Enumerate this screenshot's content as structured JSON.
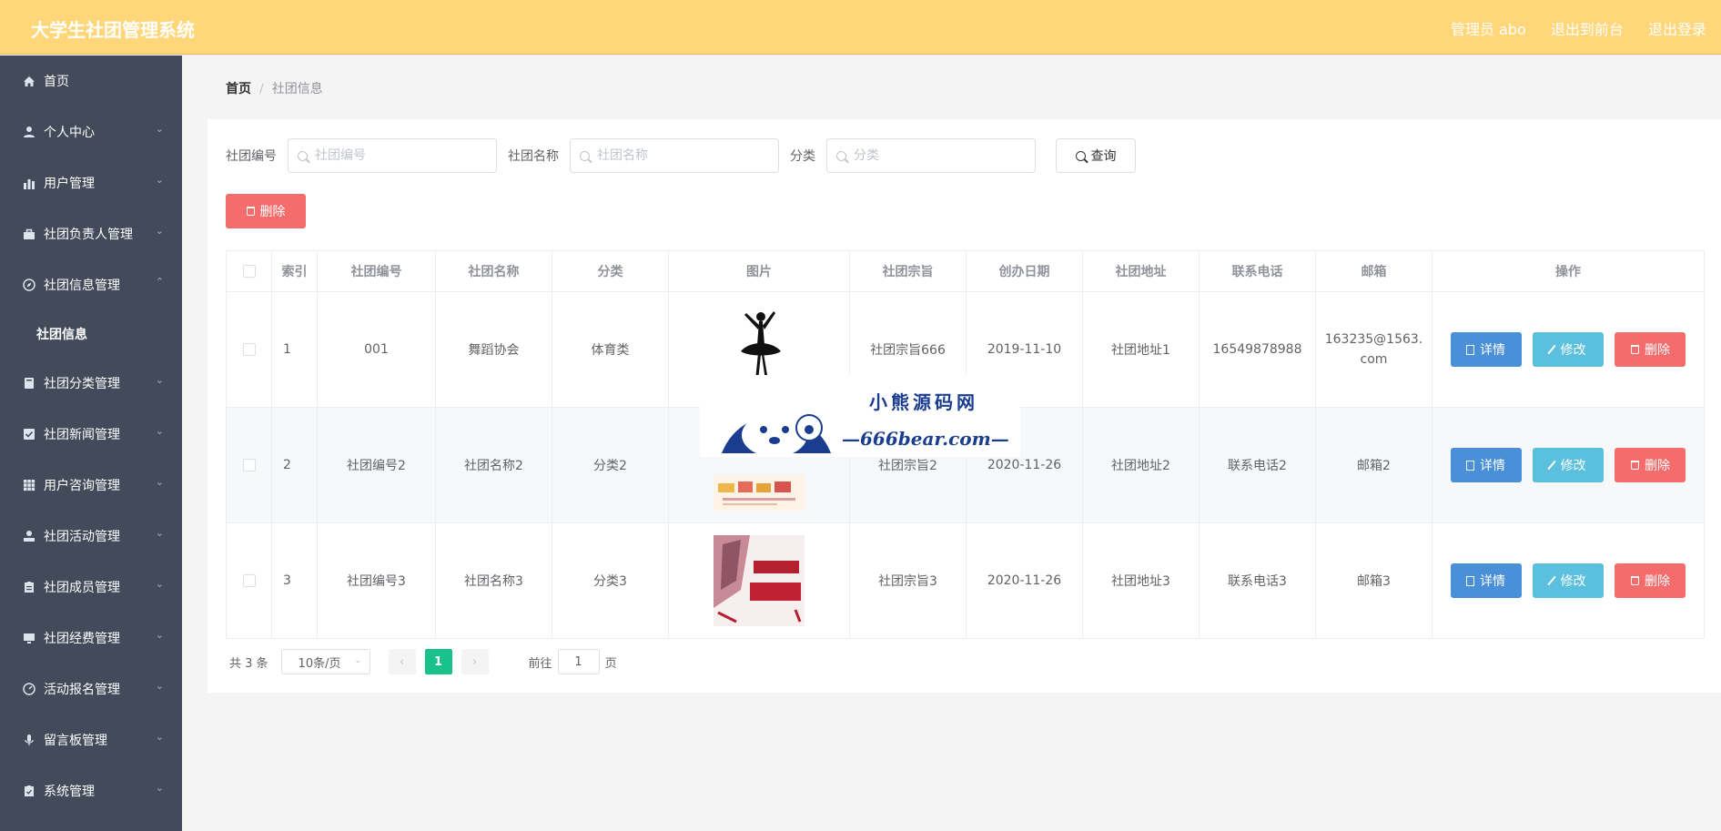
{
  "header": {
    "app_title": "大学生社团管理系统",
    "admin_label": "管理员 abo",
    "to_front_label": "退出到前台",
    "logout_label": "退出登录"
  },
  "sidebar": {
    "items": [
      {
        "label": "首页",
        "icon": "home-icon"
      },
      {
        "label": "个人中心",
        "icon": "user-icon"
      },
      {
        "label": "用户管理",
        "icon": "bar-chart-icon"
      },
      {
        "label": "社团负责人管理",
        "icon": "briefcase-icon"
      },
      {
        "label": "社团信息管理",
        "icon": "compass-icon"
      },
      {
        "label": "社团分类管理",
        "icon": "book-icon"
      },
      {
        "label": "社团新闻管理",
        "icon": "check-square-icon"
      },
      {
        "label": "用户咨询管理",
        "icon": "grid-icon"
      },
      {
        "label": "社团活动管理",
        "icon": "person-icon"
      },
      {
        "label": "社团成员管理",
        "icon": "clipboard-icon"
      },
      {
        "label": "社团经费管理",
        "icon": "monitor-icon"
      },
      {
        "label": "活动报名管理",
        "icon": "gauge-icon"
      },
      {
        "label": "留言板管理",
        "icon": "microphone-icon"
      },
      {
        "label": "系统管理",
        "icon": "clipboard-check-icon"
      }
    ],
    "sub_item": "社团信息"
  },
  "breadcrumb": {
    "home": "首页",
    "separator": "/",
    "current": "社团信息"
  },
  "search": {
    "fields": [
      {
        "label": "社团编号",
        "placeholder": "社团编号",
        "value": ""
      },
      {
        "label": "社团名称",
        "placeholder": "社团名称",
        "value": ""
      },
      {
        "label": "分类",
        "placeholder": "分类",
        "value": ""
      }
    ],
    "query_label": "查询"
  },
  "toolbar": {
    "delete_label": "删除"
  },
  "table": {
    "columns": [
      "索引",
      "社团编号",
      "社团名称",
      "分类",
      "图片",
      "社团宗旨",
      "创办日期",
      "社团地址",
      "联系电话",
      "邮箱",
      "操作"
    ],
    "rows": [
      {
        "index": "1",
        "code": "001",
        "name": "舞蹈协会",
        "category": "体育类",
        "image": "ballerina-silhouette",
        "purpose": "社团宗旨666",
        "date": "2019-11-10",
        "address": "社团地址1",
        "phone": "16549878988",
        "email": "163235@1563.com"
      },
      {
        "index": "2",
        "code": "社团编号2",
        "name": "社团名称2",
        "category": "分类2",
        "image": "club-poster",
        "purpose": "社团宗旨2",
        "date": "2020-11-26",
        "address": "社团地址2",
        "phone": "联系电话2",
        "email": "邮箱2"
      },
      {
        "index": "3",
        "code": "社团编号3",
        "name": "社团名称3",
        "category": "分类3",
        "image": "table-tennis-poster",
        "purpose": "社团宗旨3",
        "date": "2020-11-26",
        "address": "社团地址3",
        "phone": "联系电话3",
        "email": "邮箱3"
      }
    ],
    "actions": {
      "detail": "详情",
      "edit": "修改",
      "delete": "删除"
    }
  },
  "pagination": {
    "total_text": "共 3 条",
    "page_size": "10条/页",
    "current_page": "1",
    "goto_prefix": "前往",
    "goto_value": "1",
    "goto_suffix": "页"
  },
  "watermark": {
    "line1": "小熊源码网",
    "line2": "—666bear.com—"
  },
  "colors": {
    "header_bg": "#ffd67a",
    "sidebar_bg": "#434a5a",
    "detail_btn": "#4a90d9",
    "edit_btn": "#5bc0de",
    "delete_btn": "#f56c6c",
    "page_active": "#19c28a"
  }
}
